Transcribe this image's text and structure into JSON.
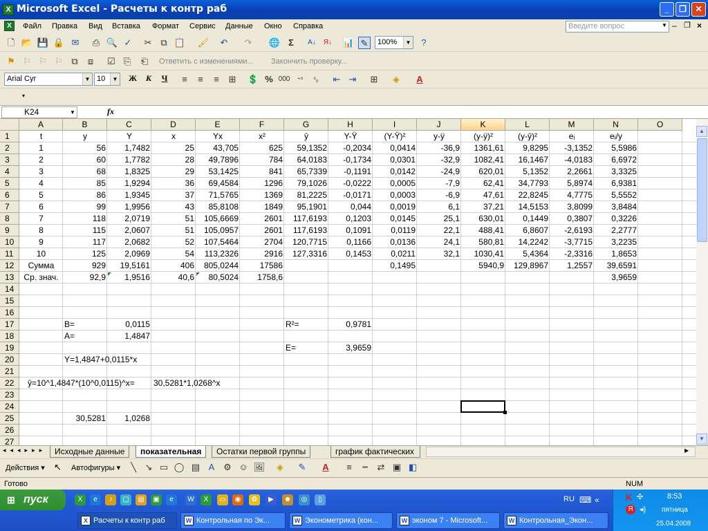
{
  "window": {
    "title": "Microsoft Excel - Расчеты к контр раб"
  },
  "menu": [
    "Файл",
    "Правка",
    "Вид",
    "Вставка",
    "Формат",
    "Сервис",
    "Данные",
    "Окно",
    "Справка"
  ],
  "ask_placeholder": "Введите вопрос",
  "toolbar": {
    "zoom": "100%",
    "review_reply": "Ответить с изменениями...",
    "review_end": "Закончить проверку..."
  },
  "format": {
    "font": "Arial Cyr",
    "size": "10",
    "bold": "Ж",
    "italic": "К",
    "underline": "Ч",
    "thousands": "000"
  },
  "formula_bar": {
    "cell": "K24",
    "fx": "fx",
    "content": ""
  },
  "columns": [
    "A",
    "B",
    "C",
    "D",
    "E",
    "F",
    "G",
    "H",
    "I",
    "J",
    "K",
    "L",
    "M",
    "N",
    "O"
  ],
  "selected_col": "K",
  "rows": [
    {
      "n": "1",
      "cells": {
        "A": "t",
        "B": "y",
        "C": "Y",
        "D": "x",
        "E": "Yx",
        "F": "x²",
        "G": "ŷ",
        "H": "Y-Ÿ",
        "I": "(Y-Ÿ)²",
        "J": "y-ÿ",
        "K": "(y-ÿ)²",
        "L": "(y-ŷ)²",
        "M": "eᵢ",
        "N": "eᵢ/y"
      }
    },
    {
      "n": "2",
      "cells": {
        "A": "1",
        "B": "56",
        "C": "1,7482",
        "D": "25",
        "E": "43,705",
        "F": "625",
        "G": "59,1352",
        "H": "-0,2034",
        "I": "0,0414",
        "J": "-36,9",
        "K": "1361,61",
        "L": "9,8295",
        "M": "-3,1352",
        "N": "5,5986"
      }
    },
    {
      "n": "3",
      "cells": {
        "A": "2",
        "B": "60",
        "C": "1,7782",
        "D": "28",
        "E": "49,7896",
        "F": "784",
        "G": "64,0183",
        "H": "-0,1734",
        "I": "0,0301",
        "J": "-32,9",
        "K": "1082,41",
        "L": "16,1467",
        "M": "-4,0183",
        "N": "6,6972"
      }
    },
    {
      "n": "4",
      "cells": {
        "A": "3",
        "B": "68",
        "C": "1,8325",
        "D": "29",
        "E": "53,1425",
        "F": "841",
        "G": "65,7339",
        "H": "-0,1191",
        "I": "0,0142",
        "J": "-24,9",
        "K": "620,01",
        "L": "5,1352",
        "M": "2,2661",
        "N": "3,3325"
      }
    },
    {
      "n": "5",
      "cells": {
        "A": "4",
        "B": "85",
        "C": "1,9294",
        "D": "36",
        "E": "69,4584",
        "F": "1296",
        "G": "79,1026",
        "H": "-0,0222",
        "I": "0,0005",
        "J": "-7,9",
        "K": "62,41",
        "L": "34,7793",
        "M": "5,8974",
        "N": "6,9381"
      }
    },
    {
      "n": "6",
      "cells": {
        "A": "5",
        "B": "86",
        "C": "1,9345",
        "D": "37",
        "E": "71,5765",
        "F": "1369",
        "G": "81,2225",
        "H": "-0,0171",
        "I": "0,0003",
        "J": "-6,9",
        "K": "47,61",
        "L": "22,8245",
        "M": "4,7775",
        "N": "5,5552"
      }
    },
    {
      "n": "7",
      "cells": {
        "A": "6",
        "B": "99",
        "C": "1,9956",
        "D": "43",
        "E": "85,8108",
        "F": "1849",
        "G": "95,1901",
        "H": "0,044",
        "I": "0,0019",
        "J": "6,1",
        "K": "37,21",
        "L": "14,5153",
        "M": "3,8099",
        "N": "3,8484"
      }
    },
    {
      "n": "8",
      "cells": {
        "A": "7",
        "B": "118",
        "C": "2,0719",
        "D": "51",
        "E": "105,6669",
        "F": "2601",
        "G": "117,6193",
        "H": "0,1203",
        "I": "0,0145",
        "J": "25,1",
        "K": "630,01",
        "L": "0,1449",
        "M": "0,3807",
        "N": "0,3226"
      }
    },
    {
      "n": "9",
      "cells": {
        "A": "8",
        "B": "115",
        "C": "2,0607",
        "D": "51",
        "E": "105,0957",
        "F": "2601",
        "G": "117,6193",
        "H": "0,1091",
        "I": "0,0119",
        "J": "22,1",
        "K": "488,41",
        "L": "6,8607",
        "M": "-2,6193",
        "N": "2,2777"
      }
    },
    {
      "n": "10",
      "cells": {
        "A": "9",
        "B": "117",
        "C": "2,0682",
        "D": "52",
        "E": "107,5464",
        "F": "2704",
        "G": "120,7715",
        "H": "0,1166",
        "I": "0,0136",
        "J": "24,1",
        "K": "580,81",
        "L": "14,2242",
        "M": "-3,7715",
        "N": "3,2235"
      }
    },
    {
      "n": "11",
      "cells": {
        "A": "10",
        "B": "125",
        "C": "2,0969",
        "D": "54",
        "E": "113,2326",
        "F": "2916",
        "G": "127,3316",
        "H": "0,1453",
        "I": "0,0211",
        "J": "32,1",
        "K": "1030,41",
        "L": "5,4364",
        "M": "-2,3316",
        "N": "1,8653"
      }
    },
    {
      "n": "12",
      "cells": {
        "A": "Сумма",
        "B": "929",
        "C": "19,5161",
        "D": "406",
        "E": "805,0244",
        "F": "17586",
        "I": "0,1495",
        "K": "5940,9",
        "L": "129,8967",
        "M": "1,2557",
        "N": "39,6591"
      }
    },
    {
      "n": "13",
      "cells": {
        "A": "Ср. знач.",
        "B": "92,9",
        "C": "1,9516",
        "D": "40,6",
        "E": "80,5024",
        "F": "1758,6",
        "N": "3,9659"
      }
    },
    {
      "n": "14",
      "cells": {}
    },
    {
      "n": "15",
      "cells": {}
    },
    {
      "n": "16",
      "cells": {}
    },
    {
      "n": "17",
      "cells": {
        "B": "B=",
        "C": "0,0115",
        "G": "R²=",
        "H": "0,9781"
      }
    },
    {
      "n": "18",
      "cells": {
        "B": "A=",
        "C": "1,4847"
      }
    },
    {
      "n": "19",
      "cells": {
        "G": "E=",
        "H": "3,9659"
      }
    },
    {
      "n": "20",
      "cells": {
        "B": "Y=1,4847+0,0115*x"
      }
    },
    {
      "n": "21",
      "cells": {}
    },
    {
      "n": "22",
      "cells": {
        "A": "ŷ=10^1,4847*(10^0,0115)^x=",
        "D": "30,5281*1,0268^x"
      }
    },
    {
      "n": "23",
      "cells": {}
    },
    {
      "n": "24",
      "cells": {}
    },
    {
      "n": "25",
      "cells": {
        "B": "30,5281",
        "C": "1,0268"
      }
    },
    {
      "n": "26",
      "cells": {}
    },
    {
      "n": "27",
      "cells": {}
    }
  ],
  "sheet_tabs": [
    "Исходные данные",
    "показательная",
    "Остатки первой группы",
    "график фактических"
  ],
  "active_tab": "показательная",
  "drawing": {
    "actions": "Действия",
    "autoshapes": "Автофигуры"
  },
  "status": {
    "left": "Готово",
    "num": "NUM"
  },
  "taskbar": {
    "start": "пуск",
    "buttons": [
      "Расчеты к контр раб",
      "Контрольная по Эк...",
      "Эконометрика (кон...",
      "эконом 7 - Microsoft...",
      "Контрольная_Экон..."
    ],
    "lang": "RU",
    "time": "8:53",
    "day": "пятница",
    "date": "25.04.2008"
  }
}
